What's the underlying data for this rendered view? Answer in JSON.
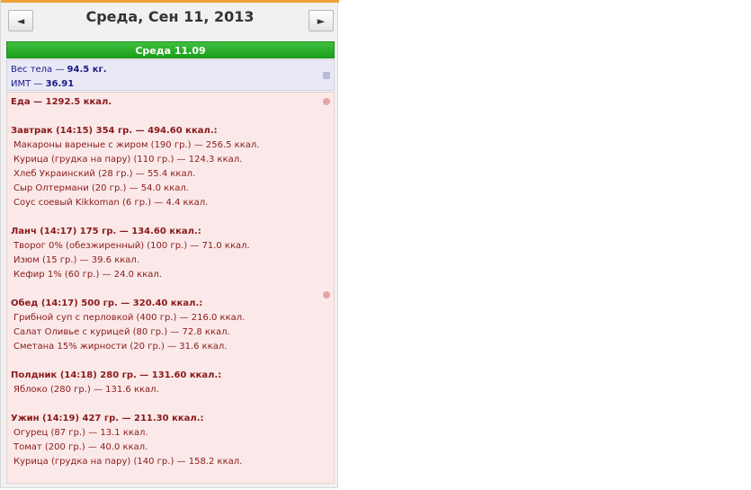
{
  "header": {
    "prev_icon": "◄",
    "next_icon": "►",
    "date_title": "Среда, Сен 11, 2013"
  },
  "day_bar": "Среда 11.09",
  "body_metrics": {
    "weight_label": "Вес тела — ",
    "weight_value": "94.5 кг.",
    "bmi_label": "ИМТ — ",
    "bmi_value": "36.91"
  },
  "food": {
    "total": "Еда — 1292.5 ккал.",
    "meals": [
      {
        "title": "Завтрак (14:15) 354 гр. — 494.60 ккал.:",
        "items": [
          "Макароны вареные с жиром (190 гр.) — 256.5 ккал.",
          "Курица (грудка на пару) (110 гр.) — 124.3 ккал.",
          "Хлеб Украинский (28 гр.) — 55.4 ккал.",
          "Сыр Олтермани (20 гр.) — 54.0 ккал.",
          "Соус соевый Kikkoman (6 гр.) — 4.4 ккал."
        ]
      },
      {
        "title": "Ланч (14:17) 175 гр. — 134.60 ккал.:",
        "items": [
          "Творог 0% (обезжиренный) (100 гр.) — 71.0 ккал.",
          "Изюм (15 гр.) — 39.6 ккал.",
          "Кефир 1% (60 гр.) — 24.0 ккал."
        ]
      },
      {
        "title": "Обед (14:17) 500 гр. — 320.40 ккал.:",
        "items": [
          "Грибной суп с перловкой (400 гр.) — 216.0 ккал.",
          "Салат Оливье с курицей (80 гр.) — 72.8 ккал.",
          "Сметана 15% жирности (20 гр.) — 31.6 ккал."
        ]
      },
      {
        "title": "Полдник (14:18) 280 гр. — 131.60 ккал.:",
        "items": [
          "Яблоко (280 гр.) — 131.6 ккал."
        ]
      },
      {
        "title": "Ужин (14:19) 427 гр. — 211.30 ккал.:",
        "items": [
          "Огурец (87 гр.) — 13.1 ккал.",
          "Томат (200 гр.) — 40.0 ккал.",
          "Курица (грудка на пару) (140 гр.) — 158.2 ккал."
        ]
      }
    ]
  },
  "icons": {
    "body": "scale-icon",
    "food": "apple-icon"
  },
  "colors": {
    "accent_orange": "#f0a23a",
    "day_bar_green": "#1a9f1a",
    "body_bg": "#e9e9f6",
    "body_text": "#1a1a8a",
    "food_bg": "#fbe9e9",
    "food_text": "#8a1a1a"
  }
}
